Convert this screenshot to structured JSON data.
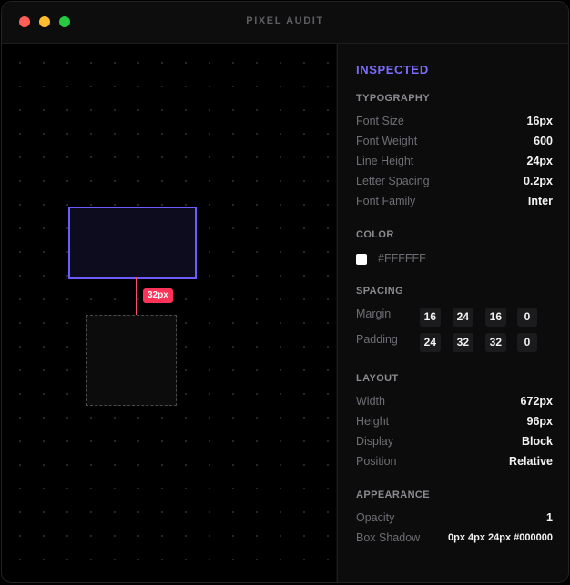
{
  "window": {
    "title": "PIXEL AUDIT"
  },
  "canvas": {
    "measurement_badge": "32px"
  },
  "panel": {
    "title": "INSPECTED",
    "typography": {
      "heading": "TYPOGRAPHY",
      "rows": [
        {
          "label": "Font Size",
          "value": "16px"
        },
        {
          "label": "Font Weight",
          "value": "600"
        },
        {
          "label": "Line Height",
          "value": "24px"
        },
        {
          "label": "Letter Spacing",
          "value": "0.2px"
        },
        {
          "label": "Font Family",
          "value": "Inter"
        }
      ]
    },
    "color": {
      "heading": "COLOR",
      "hex": "#FFFFFF",
      "swatch": "#FFFFFF"
    },
    "spacing": {
      "heading": "SPACING",
      "margin": {
        "label": "Margin",
        "values": [
          "16",
          "24",
          "16",
          "0"
        ]
      },
      "padding": {
        "label": "Padding",
        "values": [
          "24",
          "32",
          "32",
          "0"
        ]
      }
    },
    "layout": {
      "heading": "LAYOUT",
      "rows": [
        {
          "label": "Width",
          "value": "672px"
        },
        {
          "label": "Height",
          "value": "96px"
        },
        {
          "label": "Display",
          "value": "Block"
        },
        {
          "label": "Position",
          "value": "Relative"
        }
      ]
    },
    "appearance": {
      "heading": "APPEARANCE",
      "rows": [
        {
          "label": "Opacity",
          "value": "1"
        },
        {
          "label": "Box Shadow",
          "value": "0px 4px 24px #000000"
        }
      ]
    }
  },
  "colors": {
    "accent": "#6A5CFF",
    "measure": "#FF3358"
  }
}
